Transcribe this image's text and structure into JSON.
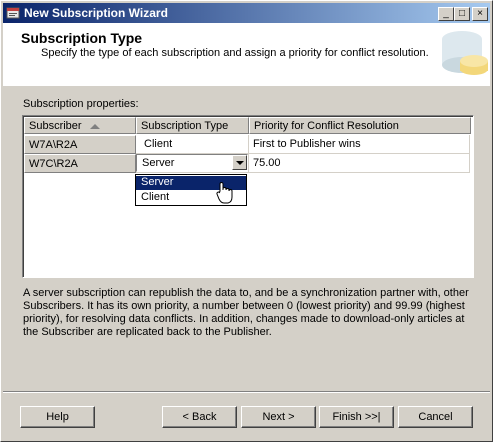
{
  "window": {
    "title": "New Subscription Wizard",
    "minimize_glyph": "_",
    "restore_glyph": "□",
    "close_glyph": "×"
  },
  "header": {
    "title": "Subscription Type",
    "subtitle": "Specify the type of each subscription and assign a priority for conflict resolution."
  },
  "properties": {
    "label": "Subscription properties:",
    "columns": [
      "Subscriber",
      "Subscription Type",
      "Priority for Conflict Resolution"
    ],
    "rows": [
      {
        "subscriber": "W7A\\R2A",
        "type": "Client",
        "priority": "First to Publisher wins"
      },
      {
        "subscriber": "W7C\\R2A",
        "type": "Server",
        "priority": "75.00"
      }
    ],
    "dropdown_options": [
      "Server",
      "Client"
    ],
    "dropdown_selected": "Server"
  },
  "description": "A server subscription can republish the data to, and be a synchronization partner with, other Subscribers. It has its own priority, a number between 0 (lowest priority) and 99.99 (highest priority), for resolving data conflicts. In addition, changes made to download-only articles at the Subscriber are replicated back to the Publisher.",
  "buttons": {
    "help": "Help",
    "back": "< Back",
    "next": "Next >",
    "finish": "Finish >>|",
    "cancel": "Cancel"
  },
  "colors": {
    "title_bar_start": "#0a246a",
    "title_bar_end": "#a6caf0",
    "selection": "#0a246a",
    "face": "#d4d0c8"
  }
}
